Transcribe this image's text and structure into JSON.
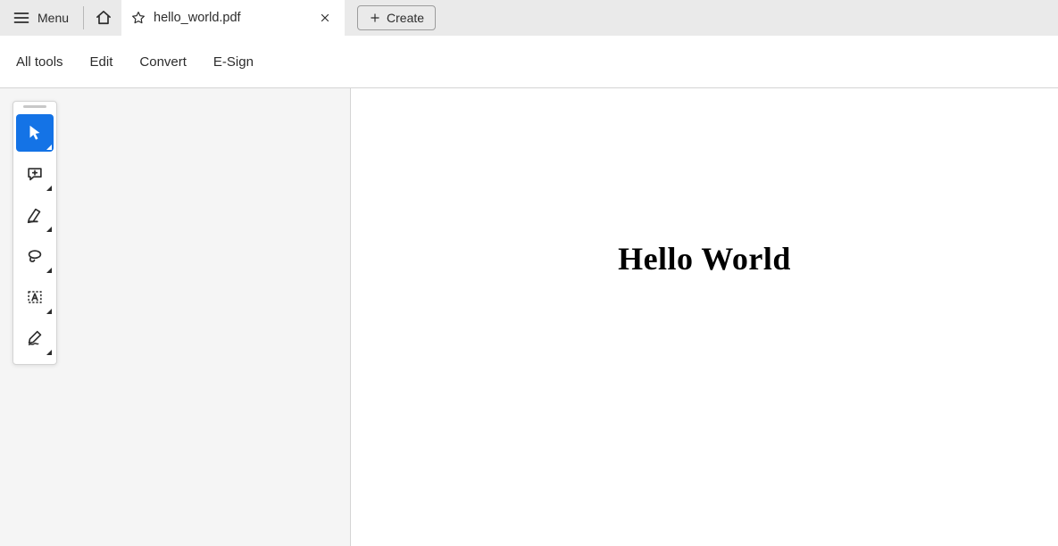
{
  "titlebar": {
    "menu_label": "Menu",
    "home_icon": "home-icon",
    "tab": {
      "title": "hello_world.pdf",
      "favorited": false
    },
    "create_label": "Create"
  },
  "menubar": {
    "items": [
      {
        "label": "All tools"
      },
      {
        "label": "Edit"
      },
      {
        "label": "Convert"
      },
      {
        "label": "E-Sign"
      }
    ]
  },
  "tool_panel": {
    "tools": [
      {
        "icon": "cursor-icon",
        "name": "selection-tool",
        "active": true
      },
      {
        "icon": "comment-icon",
        "name": "comment-tool",
        "active": false
      },
      {
        "icon": "highlight-icon",
        "name": "highlight-tool",
        "active": false
      },
      {
        "icon": "draw-icon",
        "name": "draw-tool",
        "active": false
      },
      {
        "icon": "textbox-icon",
        "name": "textbox-tool",
        "active": false
      },
      {
        "icon": "sign-icon",
        "name": "sign-tool",
        "active": false
      }
    ]
  },
  "document": {
    "content": "Hello World"
  }
}
